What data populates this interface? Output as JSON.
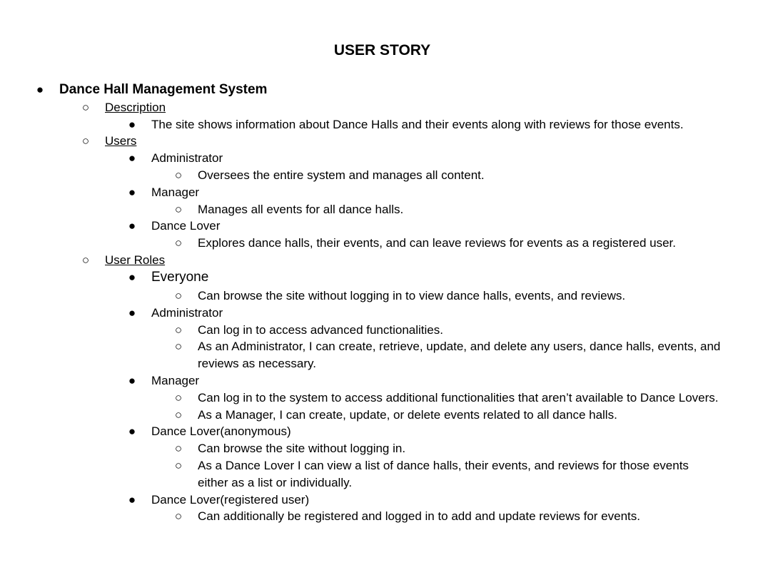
{
  "doc": {
    "title": "USER STORY",
    "section_title": "Dance Hall Management System",
    "bullets": {
      "filled": "●",
      "hollow": "○"
    },
    "description": {
      "heading": "Description",
      "text": "The site shows information about Dance Halls and their events along with reviews for those events."
    },
    "users": {
      "heading": "Users",
      "items": [
        {
          "name": "Administrator",
          "detail": "Oversees the entire system and manages all content."
        },
        {
          "name": "Manager",
          "detail": "Manages all events for all dance halls."
        },
        {
          "name": "Dance Lover",
          "detail": "Explores dance halls, their events, and can leave reviews for events as a registered user."
        }
      ]
    },
    "user_roles": {
      "heading": "User Roles",
      "roles": [
        {
          "name": "Everyone",
          "points": [
            "Can browse the site without logging in to view dance halls, events, and reviews."
          ]
        },
        {
          "name": "Administrator",
          "points": [
            "Can log in to access advanced functionalities.",
            "As an Administrator, I can create, retrieve, update, and delete any users, dance halls, events, and",
            "reviews as necessary."
          ]
        },
        {
          "name": "Manager",
          "points": [
            "Can log in to the system to access additional functionalities that aren’t available to Dance Lovers.",
            "As a Manager, I can create, update, or delete events related to all dance halls."
          ]
        },
        {
          "name": "Dance Lover(anonymous)",
          "points": [
            "Can browse the site without logging in.",
            "As a Dance Lover I can view a list of dance halls, their events, and reviews for those events",
            "either as a list or individually."
          ]
        },
        {
          "name": "Dance Lover(registered user)",
          "points": [
            "Can additionally be registered and logged in to add and update reviews for events."
          ]
        }
      ]
    }
  }
}
